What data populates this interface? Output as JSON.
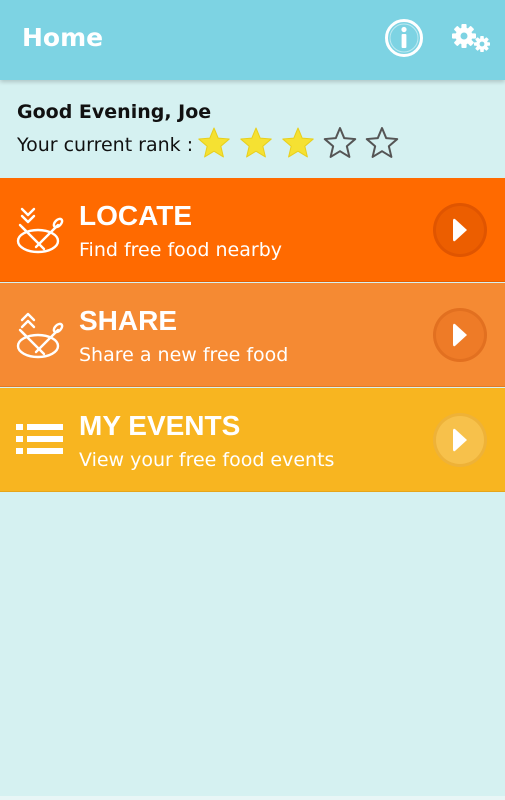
{
  "header": {
    "title": "Home",
    "info_icon": "info-icon",
    "settings_icon": "settings-gears-icon",
    "background_color": "#7dd3e3"
  },
  "greeting": {
    "text": "Good Evening, Joe",
    "rank_label": "Your current rank :",
    "rank": 3,
    "rank_max": 5,
    "star_filled_color": "#f5e132"
  },
  "menu": {
    "locate": {
      "title": "LOCATE",
      "subtitle": "Find free food nearby",
      "icon": "fork-spoon-location-icon",
      "color": "#ff6a00"
    },
    "share": {
      "title": "SHARE",
      "subtitle": "Share a new free food",
      "icon": "fork-spoon-share-icon",
      "color": "#f58a33"
    },
    "events": {
      "title": "MY EVENTS",
      "subtitle": "View your free food events",
      "icon": "list-icon",
      "color": "#f8b520"
    }
  }
}
